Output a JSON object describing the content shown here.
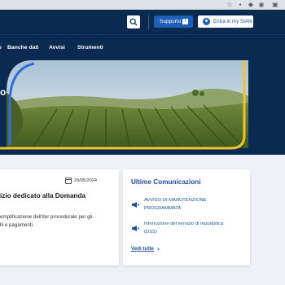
{
  "header": {
    "support_label": "Supporto",
    "support_badge": "!",
    "login_label": "Entra in my SIAN"
  },
  "nav": {
    "items": [
      {
        "label": "he"
      },
      {
        "label": "Banche dati"
      },
      {
        "label": "Avvisi"
      },
      {
        "label": "Strumenti"
      }
    ]
  },
  "hero": {
    "title_fragment": "o",
    "colors": {
      "accent_blue": "#2f6fd6",
      "accent_yellow": "#f2c230",
      "background": "#0a2a52"
    }
  },
  "news": {
    "date": "29/05/2024",
    "title_line1": "izio dedicato alla Domanda",
    "body_line1": "emplificazione dell'iter procedurale per gli",
    "body_line2": "lli e pagamenti."
  },
  "communications": {
    "title": "Ultime Comunicazioni",
    "items": [
      {
        "line1": "AVVISO DI MANUTENZIONE",
        "line2": "PROGRAMMATA",
        "icon": "megaphone-icon"
      },
      {
        "line1": "Interruzione del servizio di reportistica",
        "line2": "(DSS)",
        "icon": "megaphone-icon"
      }
    ],
    "see_all_label": "Vedi tutte"
  }
}
